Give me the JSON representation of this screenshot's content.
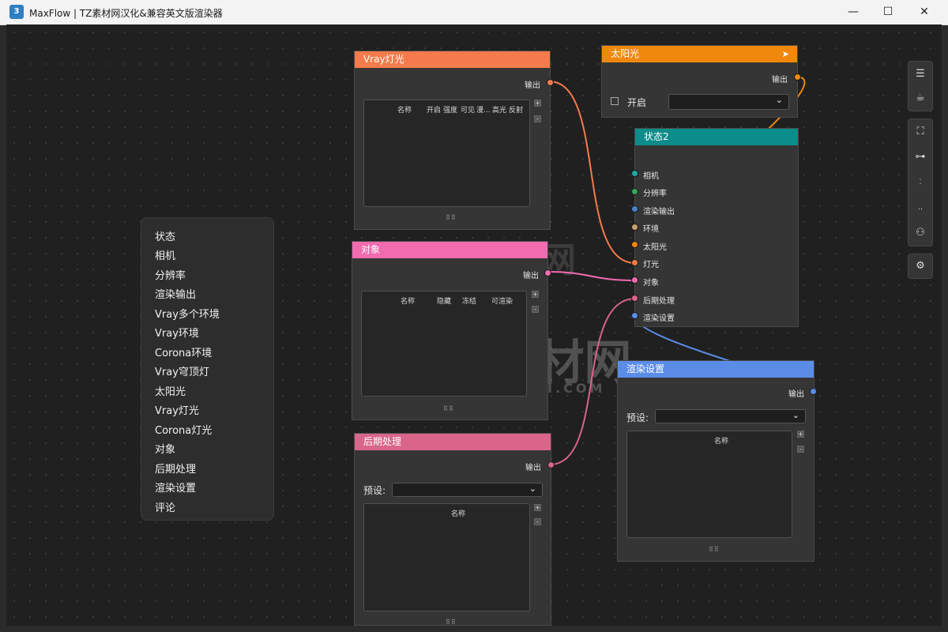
{
  "window": {
    "title": "MaxFlow | TZ素材网汉化&兼容英文版渲染器",
    "app_icon_text": "3",
    "buttons": {
      "minimize": "—",
      "maximize": "☐",
      "close": "✕"
    }
  },
  "menu": {
    "items": [
      "状态",
      "相机",
      "分辨率",
      "渲染输出",
      "Vray多个环境",
      "Vray环境",
      "Corona环境",
      "Vray穹顶灯",
      "太阳光",
      "Vray灯光",
      "Corona灯光",
      "对象",
      "后期处理",
      "渲染设置",
      "评论"
    ]
  },
  "nodes": {
    "vray_light": {
      "title": "Vray灯光",
      "color": "#f47b4b",
      "output_label": "输出",
      "columns": [
        "名称",
        "开启",
        "强度",
        "可见",
        "漫...",
        "高光",
        "反射"
      ]
    },
    "object": {
      "title": "对象",
      "color": "#f06baf",
      "output_label": "输出",
      "columns": [
        "名称",
        "隐藏",
        "冻结",
        "可渲染"
      ]
    },
    "post": {
      "title": "后期处理",
      "color": "#d9658a",
      "output_label": "输出",
      "preset_label": "预设:",
      "preset_value": "",
      "columns": [
        "名称"
      ]
    },
    "sun": {
      "title": "太阳光",
      "color": "#f0880e",
      "output_label": "输出",
      "enable_label": "开启",
      "dropdown_value": ""
    },
    "state2": {
      "title": "状态2",
      "color": "#0c8c8a",
      "inputs": [
        "相机",
        "分辨率",
        "渲染输出",
        "环境",
        "太阳光",
        "灯光",
        "对象",
        "后期处理",
        "渲染设置"
      ],
      "input_colors": [
        "#1fa8a4",
        "#3ba55d",
        "#4b84c9",
        "#c8a070",
        "#f0880e",
        "#f47b4b",
        "#f06baf",
        "#d9658a",
        "#5b8de8"
      ]
    },
    "render_settings": {
      "title": "渲染设置",
      "color": "#5b8de8",
      "output_label": "输出",
      "preset_label": "预设:",
      "preset_value": "",
      "columns": [
        "名称"
      ]
    }
  },
  "toolbar": {
    "icons": [
      "list-icon",
      "coffee-icon",
      "fit-view-icon",
      "tree-layout-icon",
      "align-vertical-icon",
      "align-horizontal-icon",
      "nodes-icon",
      "settings-icon"
    ]
  },
  "watermark": {
    "brand": "TZ素材网",
    "domain": "TZSUCAI.COM"
  },
  "grip": "⠿⠿"
}
